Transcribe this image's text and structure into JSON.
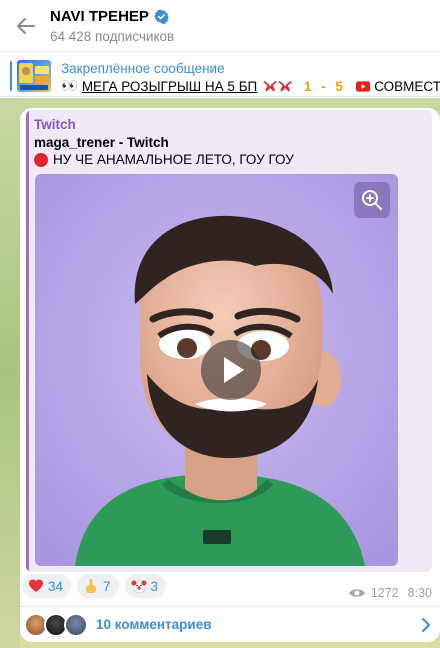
{
  "header": {
    "title": "NAVI ТРЕНЕР",
    "subscribers": "64 428 подписчиков"
  },
  "pinned": {
    "title": "Закреплённое сообщение",
    "prefix_emoji": "👀",
    "text": "МЕГА РОЗЫГРЫШ НА 5 БП",
    "suffix": "1 - 5",
    "tail_text": "СОВМЕСТ"
  },
  "post": {
    "embed": {
      "site": "Twitch",
      "title": "maga_trener - Twitch",
      "description": "НУ ЧЕ АНАМАЛЬНОЕ ЛЕТО, ГОУ ГОУ"
    },
    "reactions": [
      {
        "icon": "heart-icon",
        "count": "34"
      },
      {
        "icon": "middle-finger-icon",
        "count": "7"
      },
      {
        "icon": "clown-icon",
        "count": "3"
      }
    ],
    "views": "1272",
    "time": "8:30",
    "comments_label": "10 комментариев"
  },
  "colors": {
    "accent": "#3a8fd6",
    "twitch": "#8a55c8",
    "media_bg": "#b8a6e6",
    "shirt": "#2e9a58"
  }
}
